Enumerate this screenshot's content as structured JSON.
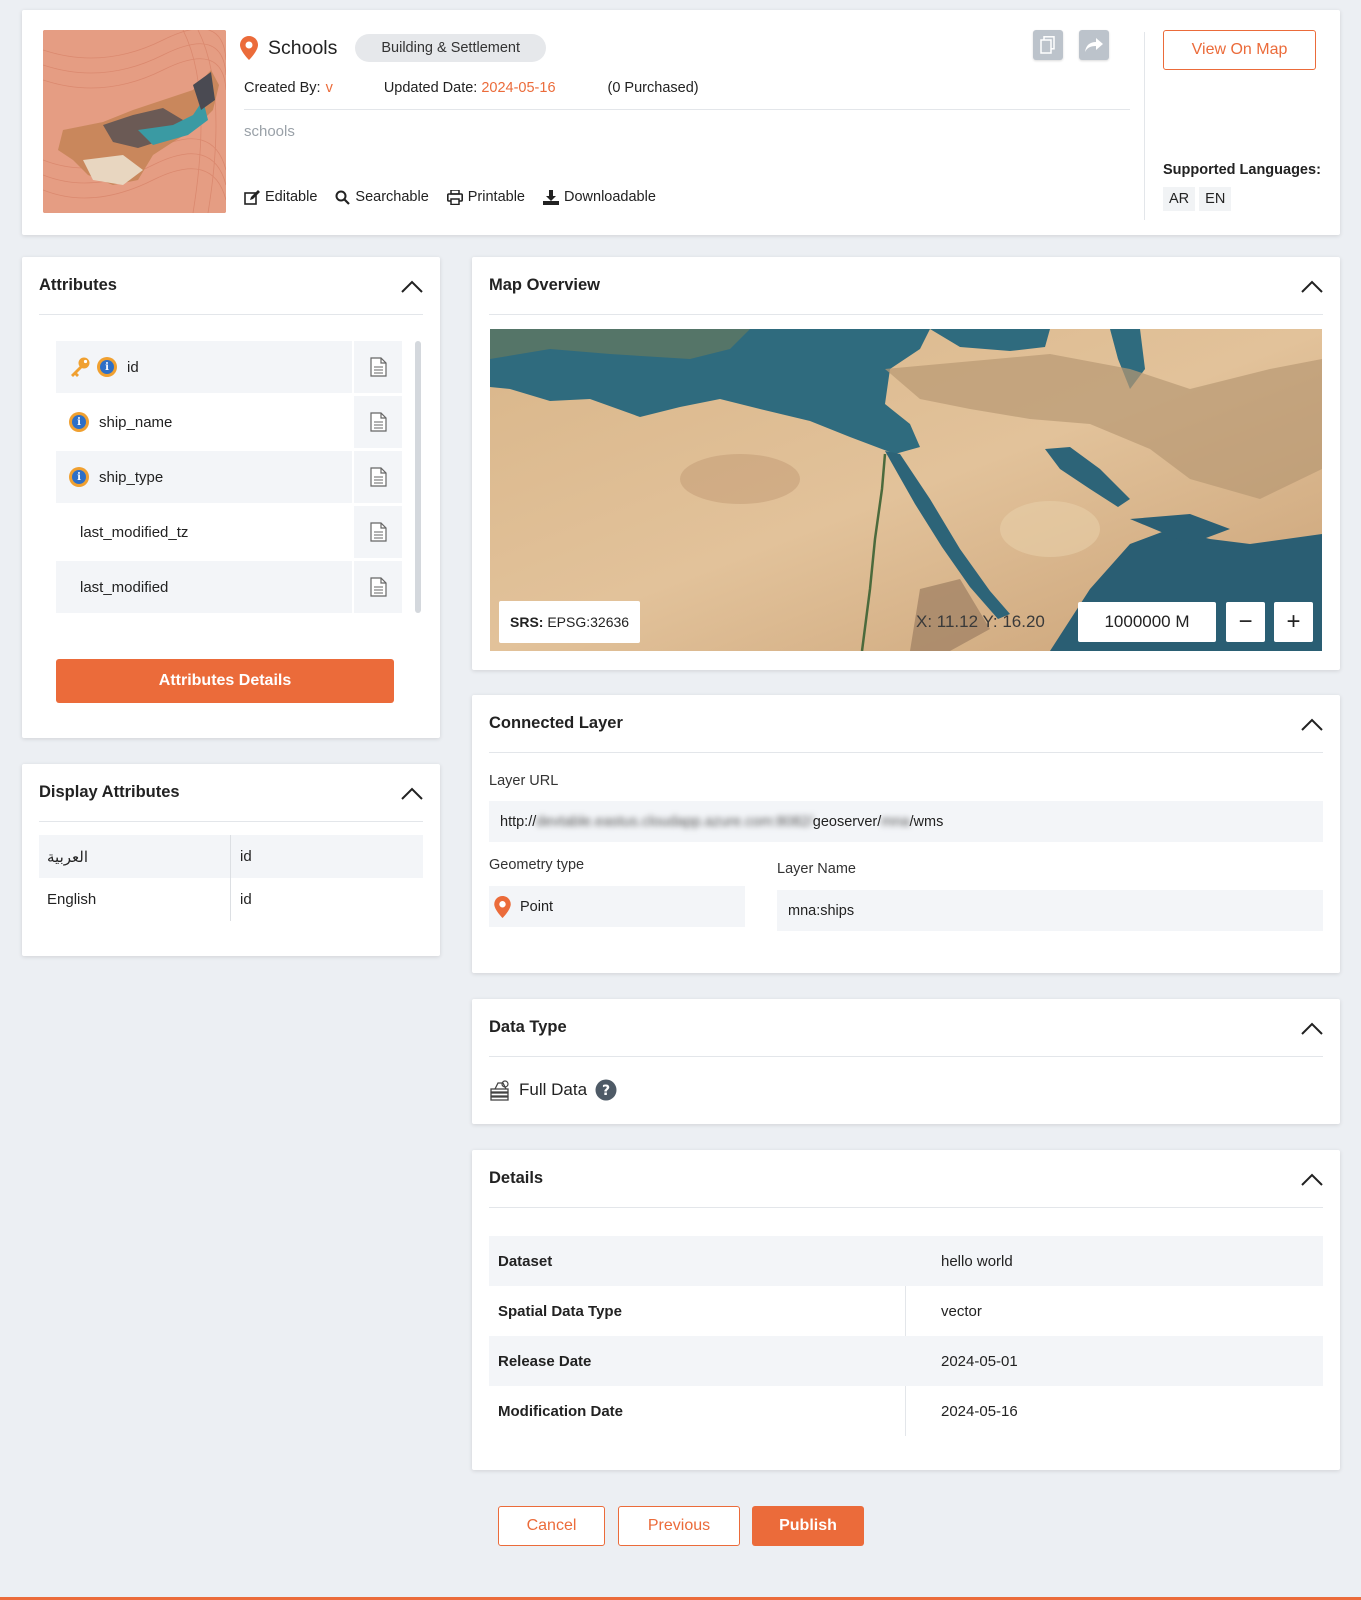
{
  "header": {
    "title": "Schools",
    "category": "Building & Settlement",
    "created_by_label": "Created By:",
    "created_by_value": "v",
    "updated_label": "Updated Date:",
    "updated_value": "2024-05-16",
    "purchased": "(0 Purchased)",
    "description": "schools",
    "flags": [
      "Editable",
      "Searchable",
      "Printable",
      "Downloadable"
    ],
    "view_on_map": "View On Map",
    "supported_languages_label": "Supported Languages:",
    "languages": [
      "AR",
      "EN"
    ]
  },
  "attributes": {
    "title": "Attributes",
    "items": [
      {
        "name": "id"
      },
      {
        "name": "ship_name"
      },
      {
        "name": "ship_type"
      },
      {
        "name": "last_modified_tz"
      },
      {
        "name": "last_modified"
      }
    ],
    "details_button": "Attributes Details"
  },
  "display_attributes": {
    "title": "Display Attributes",
    "rows": [
      {
        "lang": "العربية",
        "value": "id"
      },
      {
        "lang": "English",
        "value": "id"
      }
    ]
  },
  "map": {
    "title": "Map Overview",
    "srs_label": "SRS:",
    "srs_value": "EPSG:32636",
    "coords": "X: 11.12   Y: 16.20",
    "scale": "1000000 M",
    "zoom_out": "−",
    "zoom_in": "+"
  },
  "connected_layer": {
    "title": "Connected Layer",
    "url_label": "Layer URL",
    "url_prefix": "http://",
    "url_hidden_1": "devtable.eastus.cloudapp.azure.com:8082/",
    "url_middle": "geoserver/",
    "url_hidden_2": "mna",
    "url_suffix": "/wms",
    "geometry_label": "Geometry type",
    "geometry_value": "Point",
    "layer_name_label": "Layer Name",
    "layer_name_value": "mna:ships"
  },
  "data_type": {
    "title": "Data Type",
    "value": "Full Data"
  },
  "details": {
    "title": "Details",
    "rows": [
      {
        "label": "Dataset",
        "value": "hello world"
      },
      {
        "label": "Spatial Data Type",
        "value": "vector"
      },
      {
        "label": "Release Date",
        "value": "2024-05-01"
      },
      {
        "label": "Modification Date",
        "value": "2024-05-16"
      }
    ]
  },
  "actions": {
    "cancel": "Cancel",
    "previous": "Previous",
    "publish": "Publish"
  },
  "colors": {
    "accent": "#eb6b3a",
    "background": "#eceff3",
    "info_blue": "#2d6fc7"
  }
}
